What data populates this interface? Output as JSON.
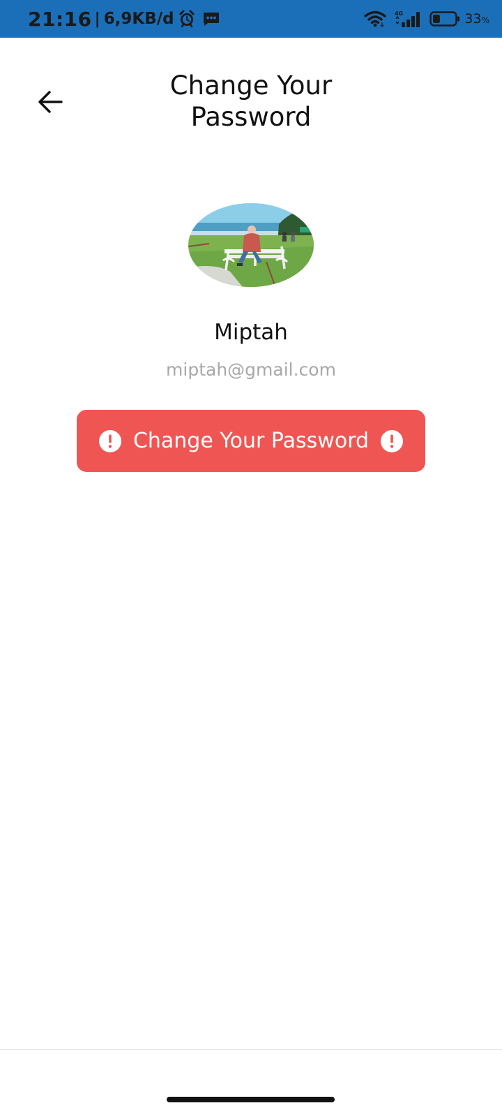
{
  "status_bar": {
    "time": "21:16",
    "separator": "|",
    "network_speed": "6,9KB/d",
    "network_type": "4G",
    "battery_percent": "33",
    "battery_unit": "%",
    "battery_level": 0.33,
    "background_color": "#1b6fb8",
    "icons": [
      "alarm-icon",
      "message-icon",
      "wifi-icon",
      "signal-icon",
      "battery-icon"
    ]
  },
  "header": {
    "back_icon": "arrow-left-icon",
    "title_line1": "Change Your",
    "title_line2": "Password"
  },
  "profile": {
    "avatar": "profile-photo",
    "name": "Miptah",
    "email": "miptah@gmail.com"
  },
  "action": {
    "label": "Change Your Password",
    "leading_icon": "alert-circle-icon",
    "trailing_icon": "alert-circle-icon",
    "color": "#ef5553"
  }
}
